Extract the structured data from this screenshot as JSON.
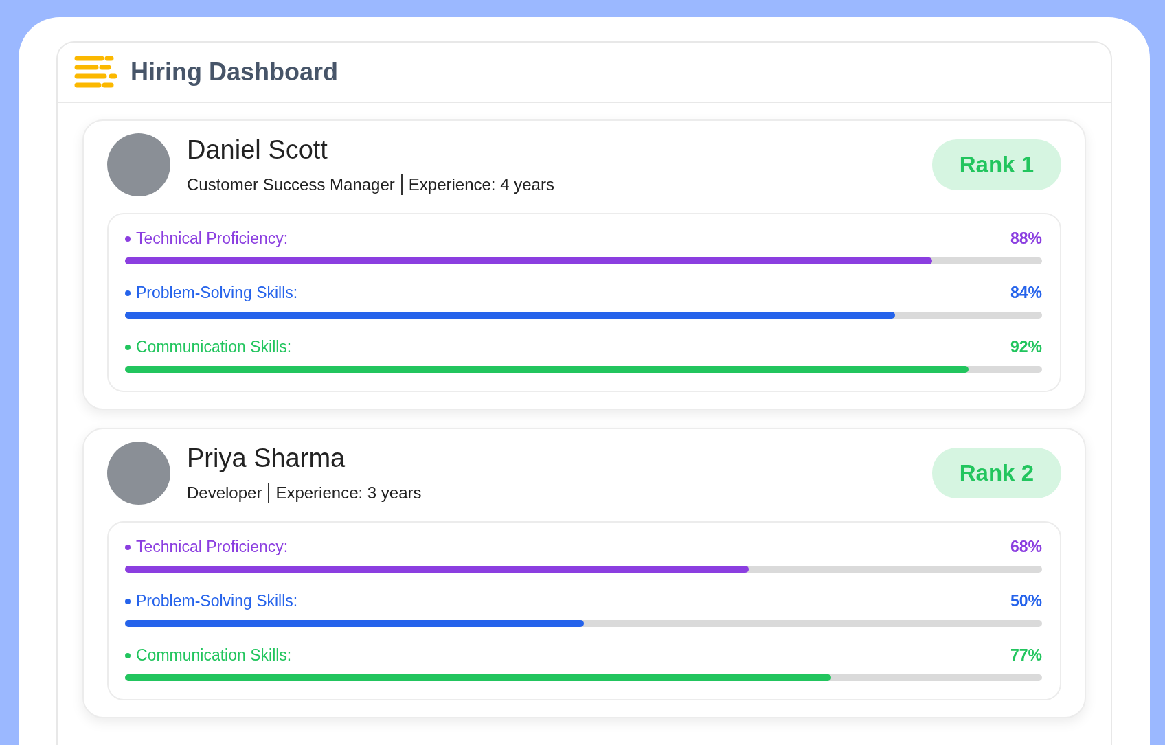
{
  "header": {
    "title": "Hiring Dashboard"
  },
  "candidates": [
    {
      "name": "Daniel Scott",
      "role": "Customer Success Manager",
      "experience": "Experience: 4 years",
      "rank": "Rank 1",
      "skills": [
        {
          "label": "Technical Proficiency:",
          "value": "88%",
          "level": 0.88,
          "color": "#8b3ee0"
        },
        {
          "label": "Problem-Solving Skills:",
          "value": "84%",
          "level": 0.84,
          "color": "#2563eb"
        },
        {
          "label": "Communication Skills:",
          "value": "92%",
          "level": 0.92,
          "color": "#22c55e"
        }
      ]
    },
    {
      "name": "Priya Sharma",
      "role": "Developer",
      "experience": "Experience: 3 years",
      "rank": "Rank 2",
      "skills": [
        {
          "label": "Technical Proficiency:",
          "value": "68%",
          "level": 0.68,
          "color": "#8b3ee0"
        },
        {
          "label": "Problem-Solving Skills:",
          "value": "50%",
          "level": 0.5,
          "color": "#2563eb"
        },
        {
          "label": "Communication Skills:",
          "value": "77%",
          "level": 0.77,
          "color": "#22c55e"
        }
      ]
    }
  ]
}
